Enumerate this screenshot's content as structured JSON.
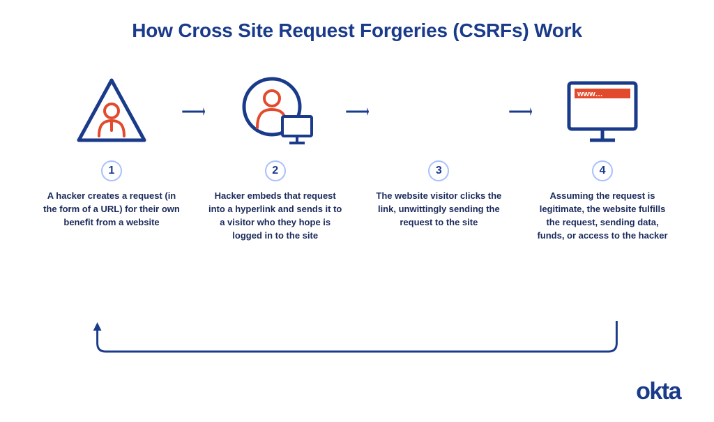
{
  "title": "How Cross Site Request Forgeries (CSRFs) Work",
  "steps": [
    {
      "num": "1",
      "text": "A hacker creates a request (in the form of a URL) for their own benefit from a website"
    },
    {
      "num": "2",
      "text": "Hacker embeds that request into a hyperlink and sends it to a visitor who they hope is logged in to the site"
    },
    {
      "num": "3",
      "text": "The website visitor clicks the link, unwittingly sending the request to the site"
    },
    {
      "num": "4",
      "text": "Assuming the request is legitimate, the website fulfills the request, sending data, funds, or access to the hacker"
    }
  ],
  "monitor_url_text": "www…",
  "brand": "okta",
  "colors": {
    "primary": "#1a3a8a",
    "accent": "#e24a2e",
    "num_border": "#a9c0ff"
  }
}
